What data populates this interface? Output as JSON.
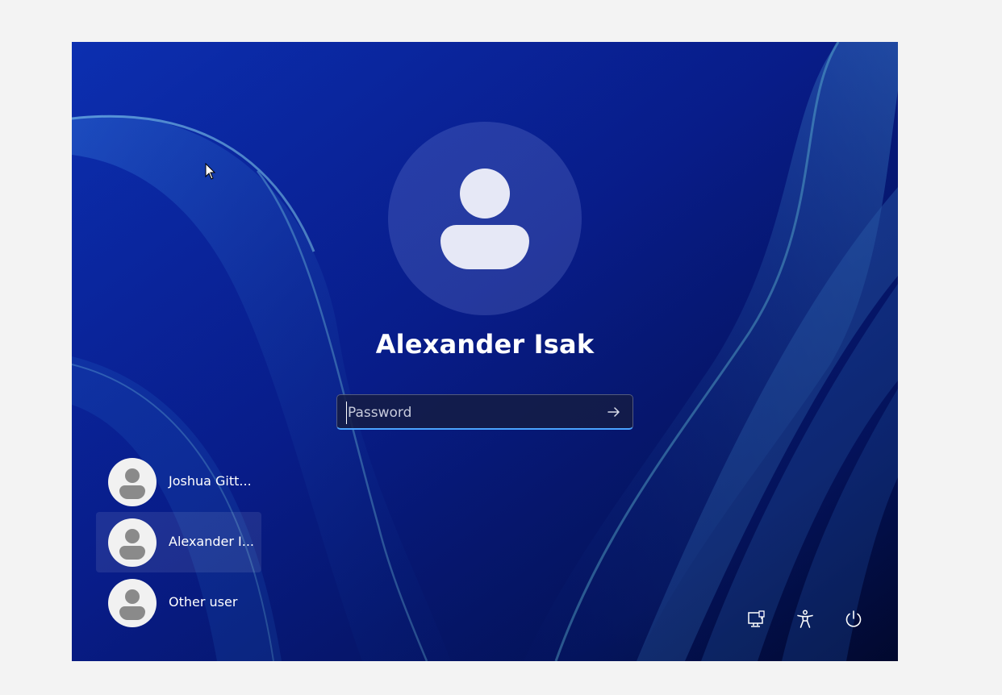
{
  "login": {
    "user_name": "Alexander Isak",
    "password_placeholder": "Password",
    "submit_icon": "arrow-right-icon"
  },
  "user_list": [
    {
      "label": "Joshua Gitt...",
      "selected": false,
      "icon": "user-avatar-icon"
    },
    {
      "label": "Alexander I...",
      "selected": true,
      "icon": "user-avatar-icon"
    },
    {
      "label": "Other user",
      "selected": false,
      "icon": "user-avatar-icon"
    }
  ],
  "tray": {
    "network_icon": "network-icon",
    "accessibility_icon": "accessibility-icon",
    "power_icon": "power-icon"
  },
  "colors": {
    "wallpaper_base": "#0a2a9e",
    "focus_accent": "#4aa3ff"
  }
}
